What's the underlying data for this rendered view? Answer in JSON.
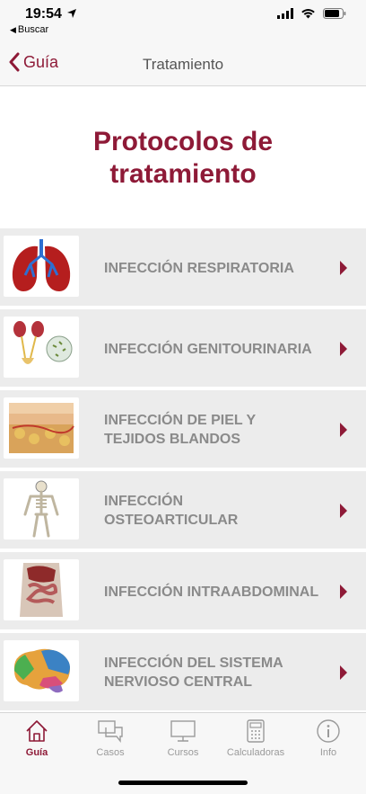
{
  "status": {
    "time": "19:54",
    "back_app": "Buscar"
  },
  "nav": {
    "back_label": "Guía",
    "title": "Tratamiento"
  },
  "hero": {
    "title": "Protocolos de tratamiento"
  },
  "items": [
    {
      "label": "INFECCIÓN RESPIRATORIA",
      "icon": "lungs-image"
    },
    {
      "label": "INFECCIÓN GENITOURINARIA",
      "icon": "kidneys-image"
    },
    {
      "label": "INFECCIÓN DE PIEL Y TEJIDOS BLANDOS",
      "icon": "skin-image"
    },
    {
      "label": "INFECCIÓN OSTEOARTICULAR",
      "icon": "skeleton-image"
    },
    {
      "label": "INFECCIÓN INTRAABDOMINAL",
      "icon": "abdomen-image"
    },
    {
      "label": "INFECCIÓN DEL SISTEMA NERVIOSO CENTRAL",
      "icon": "brain-image"
    }
  ],
  "tabs": [
    {
      "label": "Guía",
      "icon": "home-icon",
      "active": true
    },
    {
      "label": "Casos",
      "icon": "chat-icon",
      "active": false
    },
    {
      "label": "Cursos",
      "icon": "monitor-icon",
      "active": false
    },
    {
      "label": "Calculadoras",
      "icon": "calculator-icon",
      "active": false
    },
    {
      "label": "Info",
      "icon": "info-icon",
      "active": false
    }
  ],
  "colors": {
    "accent": "#8e1a37",
    "row_bg": "#ececec",
    "label": "#8a8a8a"
  }
}
